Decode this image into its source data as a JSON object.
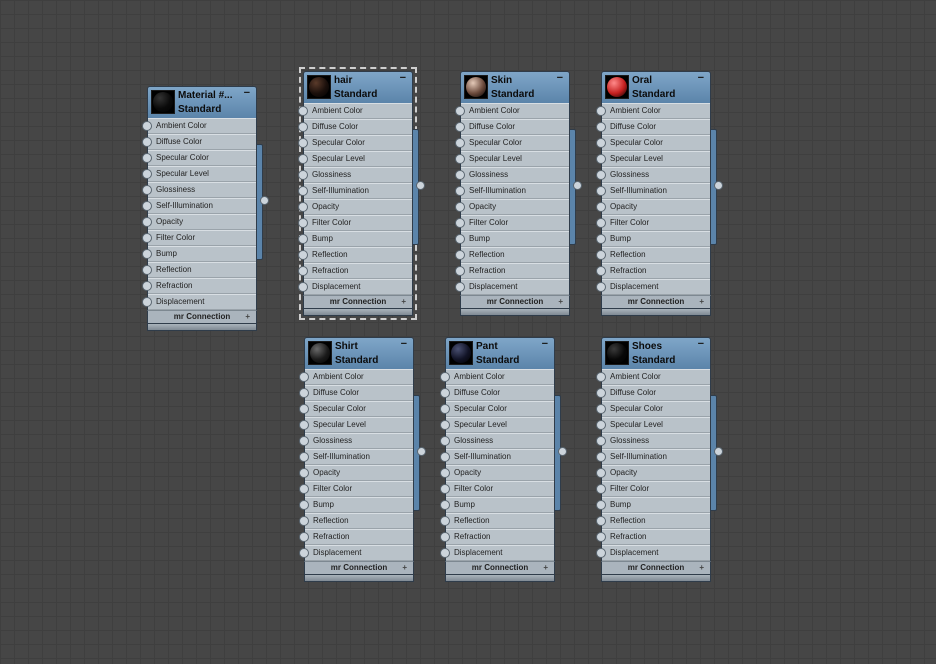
{
  "slots": [
    "Ambient Color",
    "Diffuse Color",
    "Specular Color",
    "Specular Level",
    "Glossiness",
    "Self-Illumination",
    "Opacity",
    "Filter Color",
    "Bump",
    "Reflection",
    "Refraction",
    "Displacement"
  ],
  "connection_label": "mr Connection",
  "collapse_glyph": "−",
  "expand_glyph": "+",
  "nodes": [
    {
      "name": "Material #...",
      "type": "Standard",
      "swatch": "#0a0a0a",
      "highlight": "#333333",
      "selected": false
    },
    {
      "name": "hair",
      "type": "Standard",
      "swatch": "#1a0f0b",
      "highlight": "#5a3a2a",
      "selected": true
    },
    {
      "name": "Skin",
      "type": "Standard",
      "swatch": "#6b4a3c",
      "highlight": "#e4c9b8",
      "selected": false
    },
    {
      "name": "Oral",
      "type": "Standard",
      "swatch": "#c41f1f",
      "highlight": "#ff8a8a",
      "selected": false
    },
    {
      "name": "Shirt",
      "type": "Standard",
      "swatch": "#1b1b1b",
      "highlight": "#6a6a6a",
      "selected": false
    },
    {
      "name": "Pant",
      "type": "Standard",
      "swatch": "#111326",
      "highlight": "#4a5072",
      "selected": false
    },
    {
      "name": "Shoes",
      "type": "Standard",
      "swatch": "#070707",
      "highlight": "#3a3a3a",
      "selected": false
    }
  ]
}
